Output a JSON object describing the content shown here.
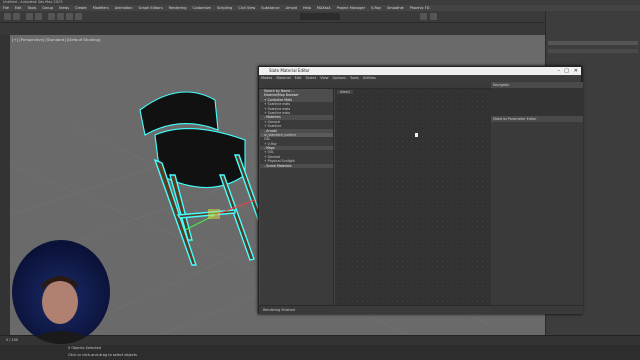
{
  "window": {
    "title": "Untitled - Autodesk 3ds Max 2023"
  },
  "menu": [
    "File",
    "Edit",
    "Tools",
    "Group",
    "Views",
    "Create",
    "Modifiers",
    "Animation",
    "Graph Editors",
    "Rendering",
    "Customize",
    "Scripting",
    "Civil View",
    "Substance",
    "Arnold",
    "Help",
    "MAXtoA",
    "Project Manager",
    "V-Ray",
    "Smoothie",
    "Phoenix FD"
  ],
  "viewport": {
    "label": "[+] [Perspective] [Standard] [Default Shading]"
  },
  "sme": {
    "title": "Slate Material Editor",
    "menu": [
      "Modes",
      "Material",
      "Edit",
      "Select",
      "View",
      "Options",
      "Tools",
      "Utilities"
    ],
    "view_tab": "View1",
    "navigator_label": "Navigator",
    "param_editor_label": "Material Parameter Editor",
    "browser_rows": [
      {
        "text": "Search by Name ...",
        "type": "hdr"
      },
      {
        "text": "Material/Map Browser",
        "type": "hdr"
      },
      {
        "text": "+ Controller Mats",
        "type": "hdr"
      },
      {
        "text": "+ Scanline mats",
        "type": "row"
      },
      {
        "text": "+ Scanline mats",
        "type": "row"
      },
      {
        "text": "+ Scanline mats",
        "type": "row"
      },
      {
        "text": "- Materials",
        "type": "hdr"
      },
      {
        "text": "+ General",
        "type": "row"
      },
      {
        "text": "+ Scanline",
        "type": "row"
      },
      {
        "text": "- Arnold",
        "type": "hdr"
      },
      {
        "text": "ai_standard_surface",
        "type": "sel"
      },
      {
        "text": "OSL",
        "type": "row"
      },
      {
        "text": "+ V-Ray",
        "type": "row"
      },
      {
        "text": "- Maps",
        "type": "hdr"
      },
      {
        "text": "+ OSL",
        "type": "row"
      },
      {
        "text": "+ General",
        "type": "row"
      },
      {
        "text": "+ Physical Sunlight",
        "type": "row"
      },
      {
        "text": "- Scene Materials",
        "type": "hdr"
      }
    ],
    "status": "Rendering finished"
  },
  "status_bar": {
    "text": "0 Objects Selected",
    "prompt": "Click or click-and-drag to select objects"
  },
  "timeline": {
    "frame": "0 / 100"
  }
}
